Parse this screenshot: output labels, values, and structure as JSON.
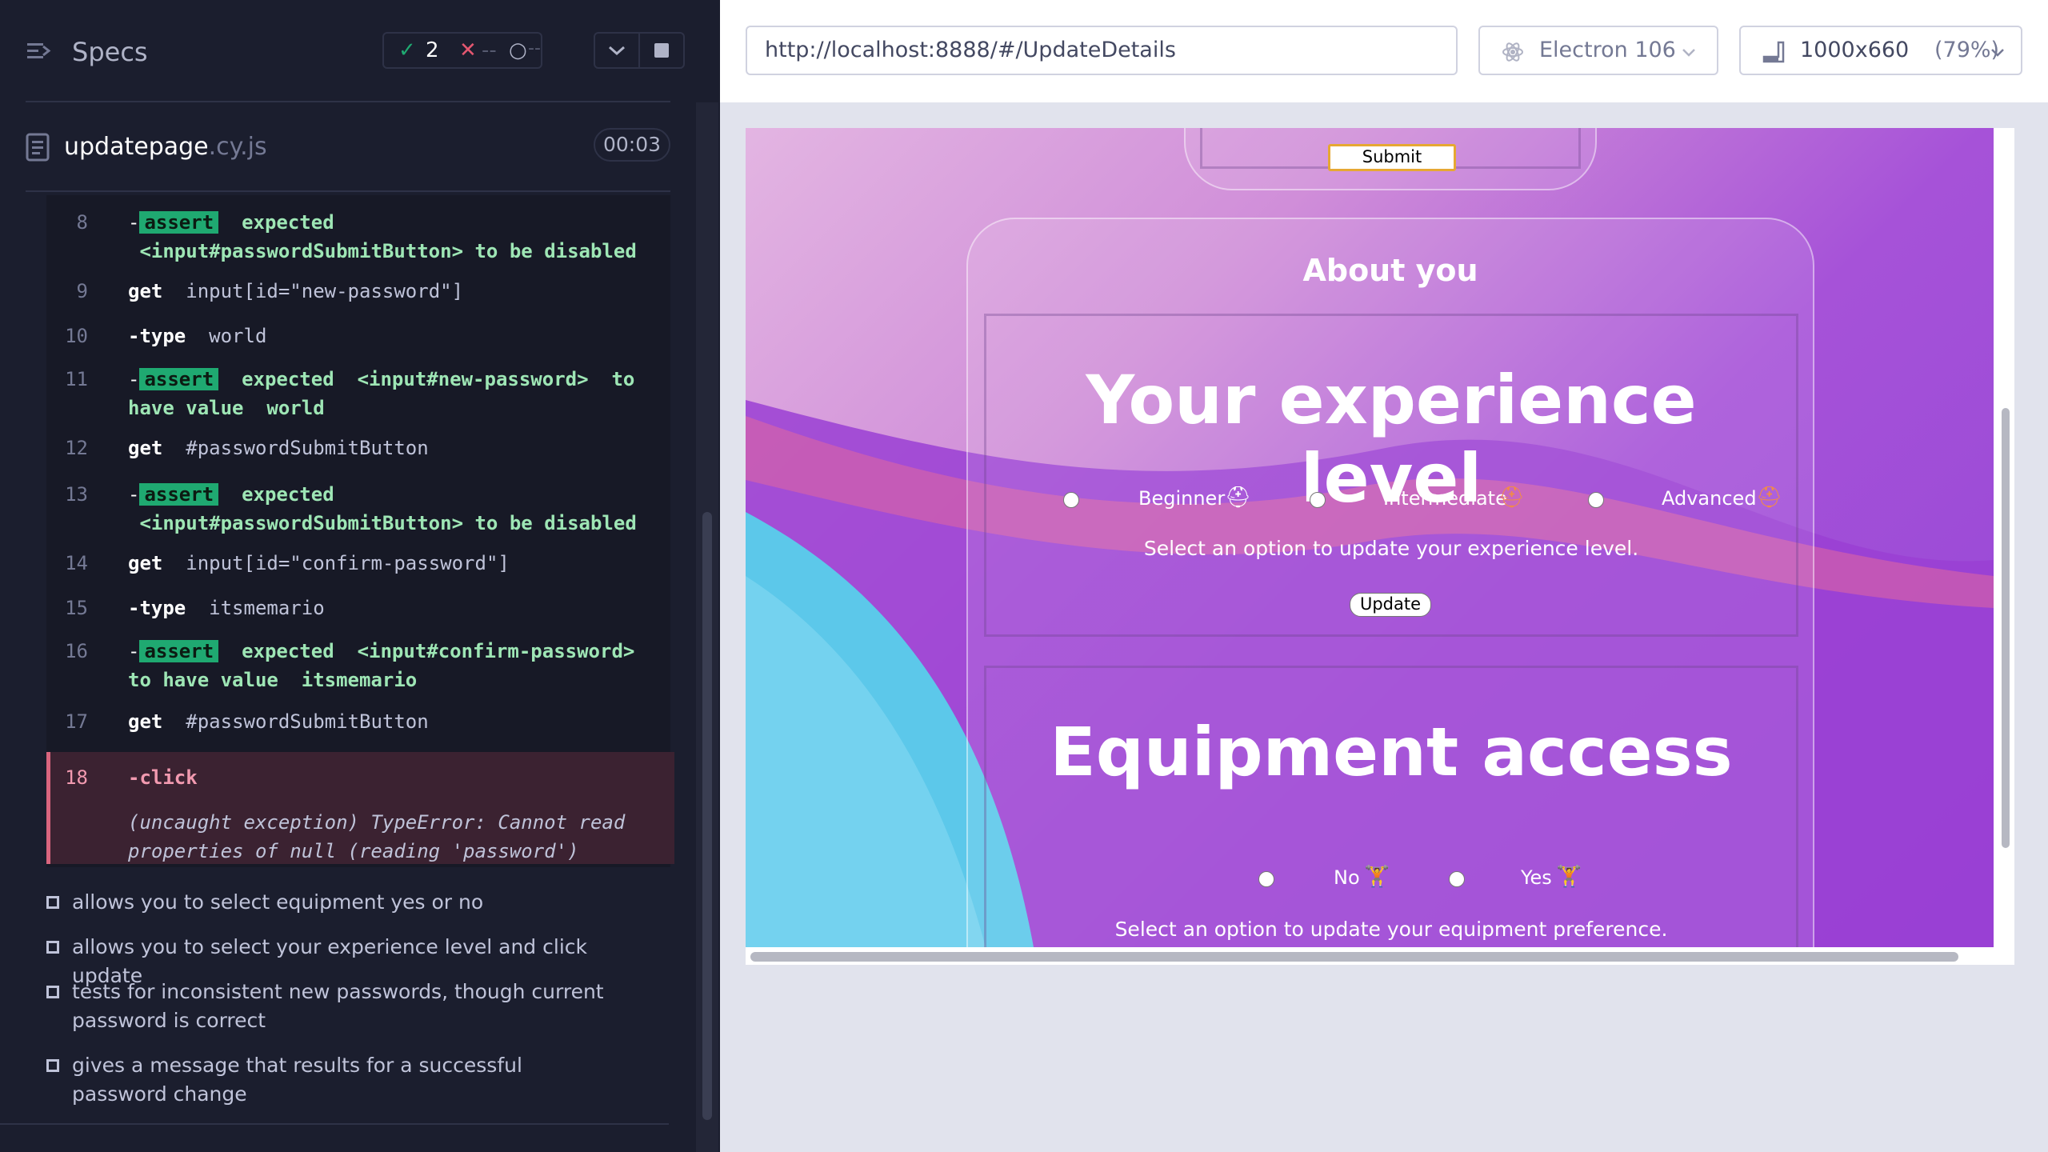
{
  "reporter": {
    "title": "Specs",
    "stats": {
      "passed": "2",
      "failed": "--",
      "pending": "--"
    },
    "spec": {
      "name": "updatepage",
      "ext": ".cy.js",
      "duration": "00:03"
    },
    "commands": [
      {
        "num": "8",
        "line1_kw": "-",
        "badge": "assert",
        "line1_rest": "expected",
        "line2a": "<input#passwordSubmitButton>",
        "line2b": "to be",
        "line2c": "disabled"
      },
      {
        "num": "9",
        "cmd": "get",
        "arg": "input[id=\"new-password\"]"
      },
      {
        "num": "10",
        "cmd": "-type",
        "arg": "world"
      },
      {
        "num": "11",
        "badge": "assert",
        "a": "expected",
        "b": "<input#new-password>",
        "c": "to",
        "d": "have value",
        "e": "world"
      },
      {
        "num": "12",
        "cmd": "get",
        "arg": "#passwordSubmitButton"
      },
      {
        "num": "13",
        "badge": "assert",
        "a": "expected",
        "b": "<input#passwordSubmitButton>",
        "c": "to be",
        "d": "disabled"
      },
      {
        "num": "14",
        "cmd": "get",
        "arg": "input[id=\"confirm-password\"]"
      },
      {
        "num": "15",
        "cmd": "-type",
        "arg": "itsmemario"
      },
      {
        "num": "16",
        "badge": "assert",
        "a": "expected",
        "b": "<input#confirm-password>",
        "c": "to have value",
        "d": "itsmemario"
      },
      {
        "num": "17",
        "cmd": "get",
        "arg": "#passwordSubmitButton"
      },
      {
        "num": "18",
        "cmd": "-click",
        "error1": "(uncaught exception)  TypeError: Cannot read",
        "error2": "properties of null (reading 'password')"
      }
    ],
    "tests": [
      "allows you to select equipment yes or no",
      "allows you to select your experience level and click update",
      "tests for inconsistent new passwords, though current password is correct",
      "gives a message that results for a successful password change"
    ]
  },
  "aut": {
    "url": "http://localhost:8888/#/UpdateDetails",
    "browser": "Electron 106",
    "viewport": "1000x660",
    "scale": "(79%)"
  },
  "app": {
    "submit_label": "Submit",
    "about_title": "About you",
    "experience": {
      "heading": "Your experience level",
      "options": [
        "Beginner",
        "Intermediate",
        "Advanced"
      ],
      "hint": "Select an option to update your experience level.",
      "button": "Update"
    },
    "equipment": {
      "heading": "Equipment access",
      "options": [
        "No",
        "Yes"
      ],
      "hint": "Select an option to update your equipment preference."
    }
  },
  "colors": {
    "pass": "#1fa971",
    "fail": "#d9657e",
    "accent_purple": "#a652d8"
  }
}
